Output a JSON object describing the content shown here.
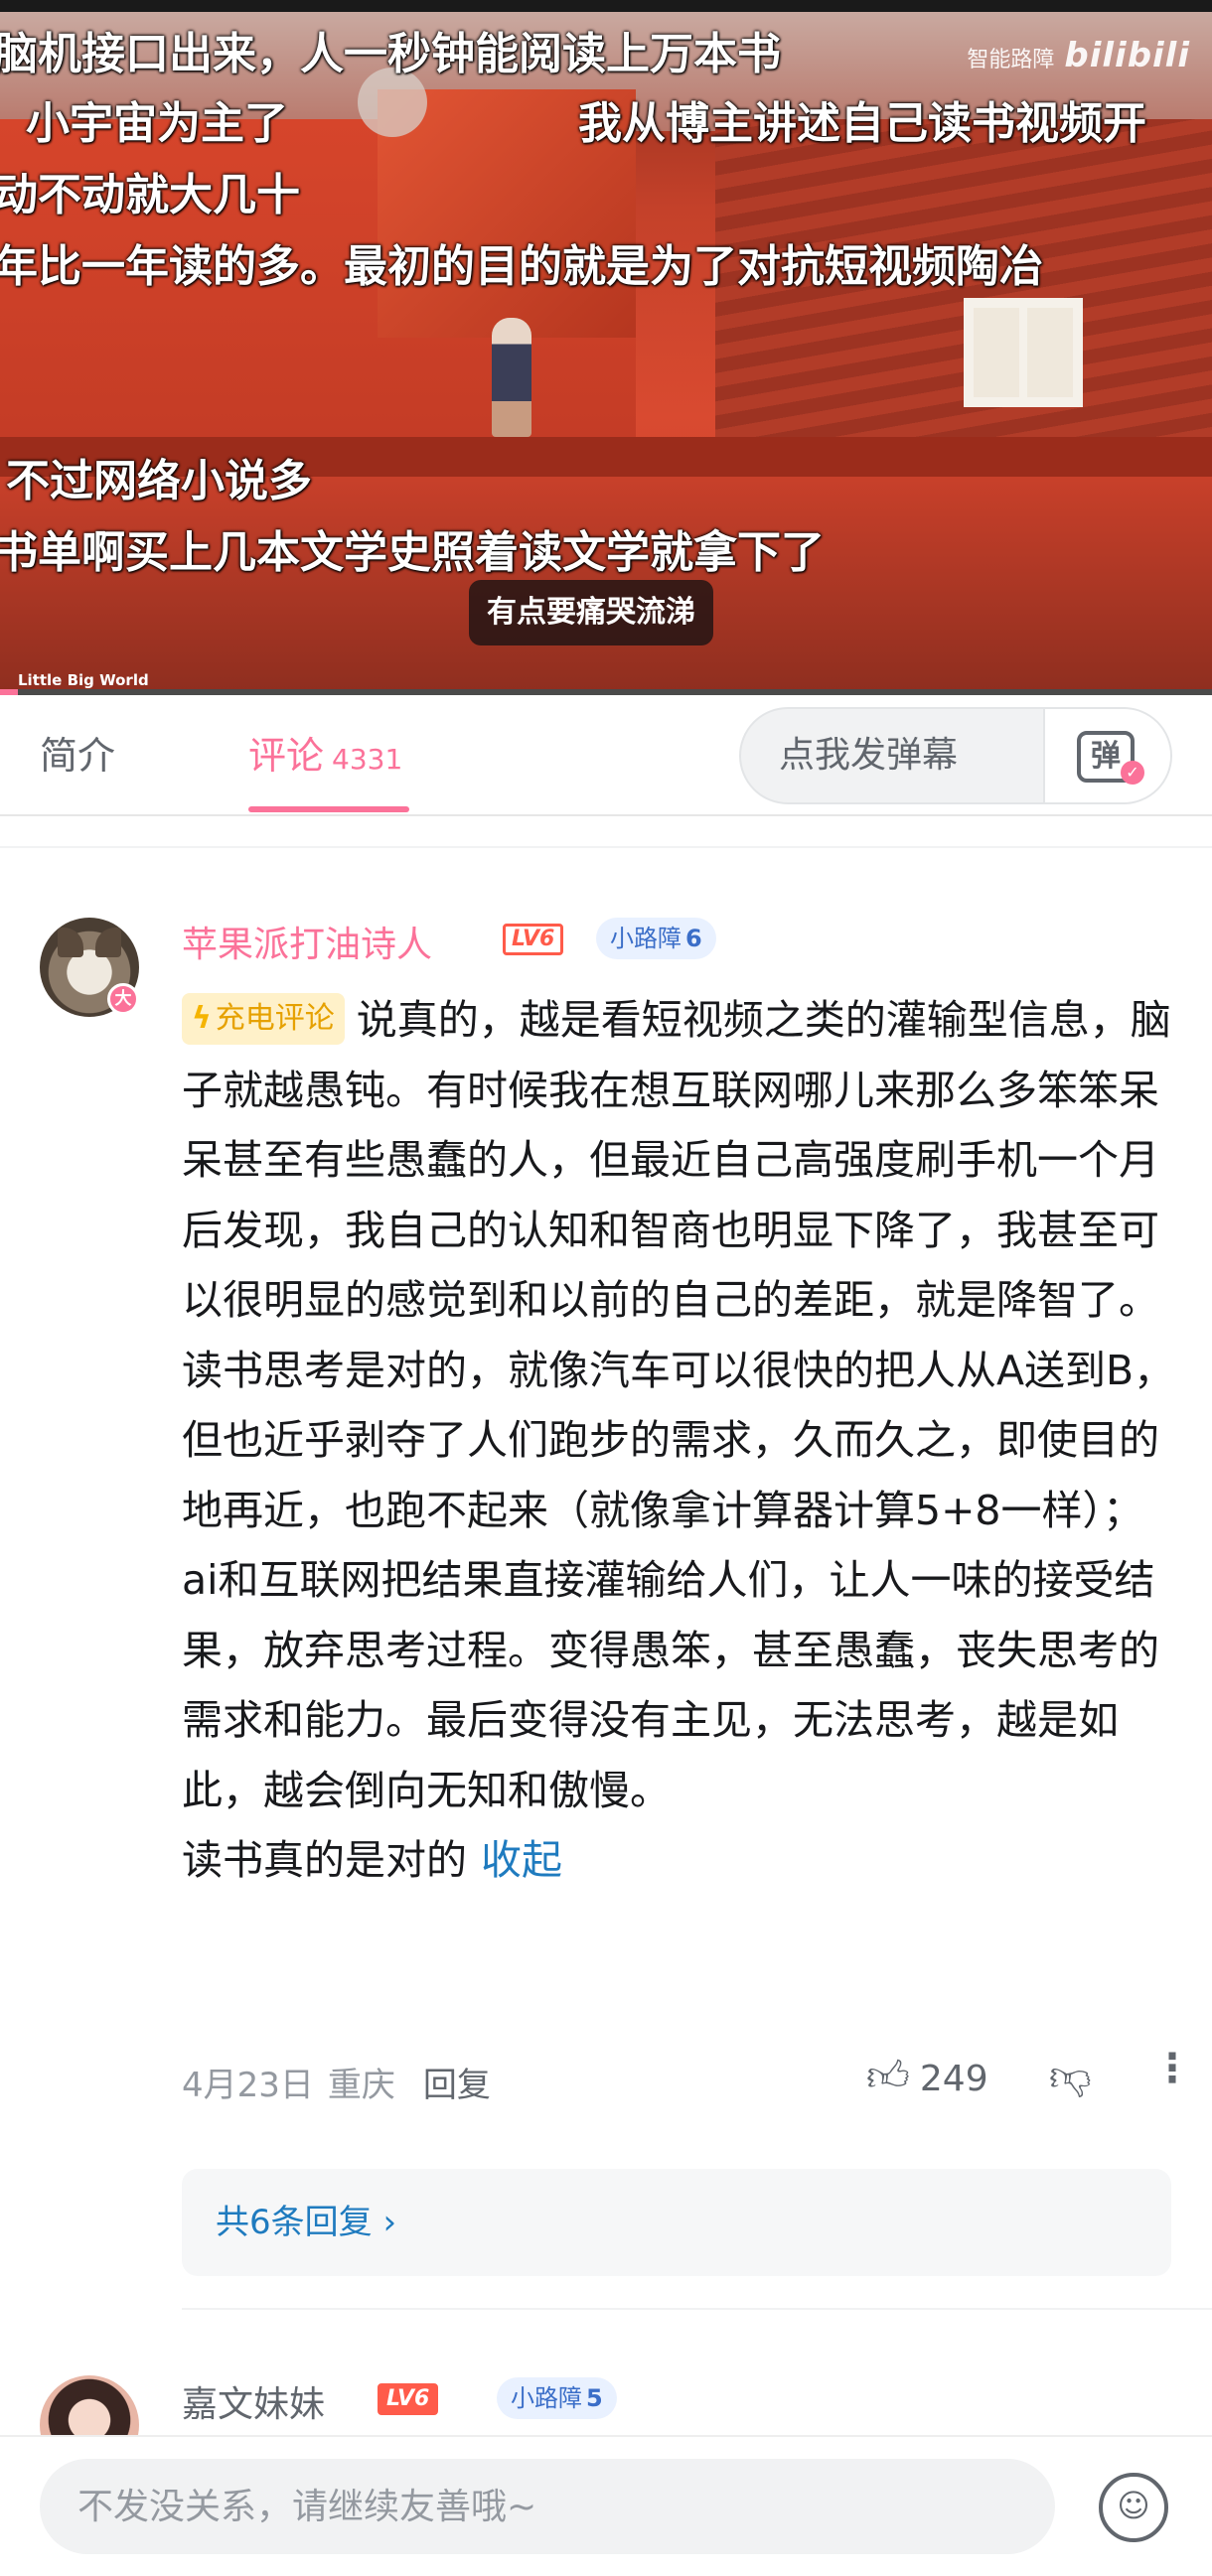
{
  "video": {
    "danmaku": [
      "脑机接口出来，人一秒钟能阅读上万本书",
      "小宇宙为主了",
      "我从博主讲述自己读书视频开",
      "动不动就大几十",
      "年比一年读的多。最初的目的就是为了对抗短视频陶冶",
      "不过网络小说多",
      "书单啊买上几本文学史照着读文学就拿下了"
    ],
    "watermark_label": "智能路障",
    "watermark_brand": "bilibili",
    "subtitle": "有点要痛哭流涕",
    "corner_watermark": "Little Big World"
  },
  "tabs": {
    "intro": "简介",
    "comments": "评论",
    "comments_count": "4331",
    "danmaku_placeholder": "点我发弹幕",
    "danmaku_toggle_glyph": "弹"
  },
  "comments": [
    {
      "username": "苹果派打油诗人",
      "avatar_badge": "大",
      "level": "LV6",
      "fan_badge_name": "小路障",
      "fan_badge_level": "6",
      "tag": "充电评论",
      "text": "说真的，越是看短视频之类的灌输型信息，脑子就越愚钝。有时候我在想互联网哪儿来那么多笨笨呆呆甚至有些愚蠢的人，但最近自己高强度刷手机一个月后发现，我自己的认知和智商也明显下降了，我甚至可以很明显的感觉到和以前的自己的差距，就是降智了。读书思考是对的，就像汽车可以很快的把人从A送到B，但也近乎剥夺了人们跑步的需求，久而久之，即使目的地再近，也跑不起来（就像拿计算器计算5+8一样）； ai和互联网把结果直接灌输给人们，让人一味的接受结果，放弃思考过程。变得愚笨，甚至愚蠢，丧失思考的需求和能力。最后变得没有主见，无法思考，越是如此，越会倒向无知和傲慢。",
      "text_last_line": "读书真的是对的",
      "collapse_label": "收起",
      "date": "4月23日",
      "location": "重庆",
      "reply_label": "回复",
      "likes": "249",
      "replies_label": "共6条回复"
    },
    {
      "username": "嘉文妹妹",
      "level": "LV6",
      "fan_badge_name": "小路障",
      "fan_badge_level": "5"
    }
  ],
  "input": {
    "placeholder": "不发没关系，请继续友善哦~"
  },
  "icons": {
    "like": "thumbs-up-icon",
    "dislike": "thumbs-down-icon",
    "more": "more-vertical-icon",
    "emoji": "emoji-icon",
    "chevron": "chevron-right-icon",
    "bolt": "lightning-icon"
  },
  "colors": {
    "accent_pink": "#fb7299",
    "link_blue": "#1f7bbf",
    "level_red": "#ff5b4a",
    "charge_gold": "#e6a100"
  },
  "progress_fraction": 0.015
}
